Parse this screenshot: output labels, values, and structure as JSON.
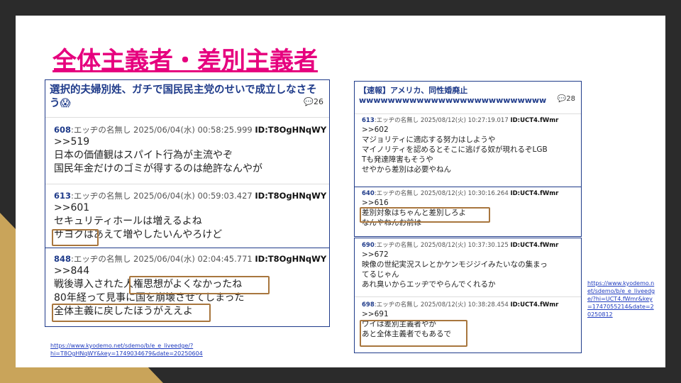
{
  "title": "全体主義者・差別主義者",
  "left_panel": {
    "thread_title": "選択的夫婦別姓、ガチで国民民主党のせいで成立しなさそう😱",
    "count": "26",
    "posts": [
      {
        "num": "608",
        "header": ":エッヂの名無し 2025/06/04(水) 00:58:25.999 ",
        "id": "ID:T8OgHNqWY",
        "lines": [
          ">>519",
          "日本の価値観はスパイト行為が主流やぞ",
          "国民年金だけのゴミが得するのは絶許なんやが"
        ]
      },
      {
        "num": "613",
        "header": ":エッヂの名無し 2025/06/04(水) 00:59:03.427 ",
        "id": "ID:T8OgHNqWY",
        "lines": [
          ">>601",
          "セキュリティホールは増えるよね",
          "サヨクはあえて増やしたいんやろけど"
        ]
      },
      {
        "num": "848",
        "header": ":エッヂの名無し 2025/06/04(水) 02:04:45.771 ",
        "id": "ID:T8OgHNqWY",
        "lines": [
          ">>844",
          "戦後導入された人権思想がよくなかったね",
          "80年経って見事に国を崩壊させてしまった",
          "全体主義に戻したほうがええよ"
        ]
      }
    ],
    "url": "https://www.kyodemo.net/sdemo/b/e_e_liveedge/?hi=T8OgHNqWY&key=1749034679&date=20250604"
  },
  "right_panel": {
    "thread_title": "【速報】アメリカ、同性婚廃止wwwwwwwwwwwwwwwwwwwwwwwwww",
    "count": "28",
    "posts": [
      {
        "num": "613",
        "header": ":エッヂの名無し 2025/08/12(火) 10:27:19.017 ",
        "id": "ID:UCT4.fWmr",
        "lines": [
          ">>602",
          "マジョリティに適応する努力はしようや",
          "マイノリティを認めるとそこに逃げる奴が現れるぞLGB",
          "Tも発達障害もそうや",
          "せやから差別は必要やねん"
        ]
      },
      {
        "num": "640",
        "header": ":エッヂの名無し 2025/08/12(火) 10:30:16.264 ",
        "id": "ID:UCT4.fWmr",
        "lines": [
          ">>616",
          "差別対象はちゃんと差別しろよ",
          "なんやねんお前は"
        ]
      }
    ]
  },
  "right_panel2": {
    "posts": [
      {
        "num": "690",
        "header": ":エッヂの名無し 2025/08/12(火) 10:37:30.125 ",
        "id": "ID:UCT4.fWmr",
        "lines": [
          ">>672",
          "映像の世紀実況スレとかケンモジジイみたいなの集まっ",
          "てるじゃん",
          "あれ臭いからエッヂでやらんでくれるか"
        ]
      },
      {
        "num": "698",
        "header": ":エッヂの名無し 2025/08/12(火) 10:38:28.454 ",
        "id": "ID:UCT4.fWmr",
        "lines": [
          ">>691",
          "ワイは差別主義者やが",
          "あと全体主義者でもあるで"
        ]
      }
    ],
    "url": "https://www.kyodemo.net/sdemo/b/e_e_liveedge/?hi=UCT4.fWmr&key=1747055214&date=20250812"
  },
  "colors": {
    "title": "#e6007e",
    "link": "#1f3b8a",
    "highlight_box": "#a8763e",
    "background_dark": "#2b2b2b",
    "accent_gold": "#c9a45a"
  }
}
